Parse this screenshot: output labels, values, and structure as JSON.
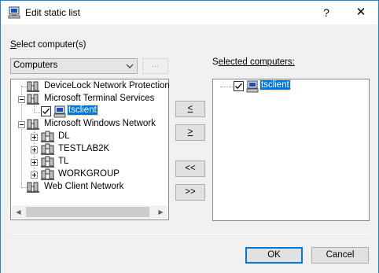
{
  "window": {
    "title": "Edit static list",
    "help_glyph": "?",
    "close_glyph": "✕"
  },
  "left": {
    "label_prefix": "S",
    "label_rest": "elect computer(s)",
    "combo_value": "Computers",
    "browse_label": "...",
    "tree": [
      {
        "label": "DeviceLock Network Protection",
        "icon": "network-icon"
      },
      {
        "label": "Microsoft Terminal Services",
        "icon": "network-icon",
        "expanded": true
      },
      {
        "label": "tsclient",
        "icon": "computer-icon",
        "checked": true,
        "selected": true
      },
      {
        "label": "Microsoft Windows Network",
        "icon": "network-icon",
        "expanded": true
      },
      {
        "label": "DL",
        "icon": "domain-icon"
      },
      {
        "label": "TESTLAB2K",
        "icon": "domain-icon"
      },
      {
        "label": "TL",
        "icon": "domain-icon"
      },
      {
        "label": "WORKGROUP",
        "icon": "domain-icon"
      },
      {
        "label": "Web Client Network",
        "icon": "network-icon"
      }
    ]
  },
  "right": {
    "label_prefix": "S",
    "label_rest": "elected computers:",
    "tree": [
      {
        "label": "tsclient",
        "icon": "computer-icon",
        "checked": true,
        "selected": true
      }
    ]
  },
  "move_buttons": {
    "add": "<",
    "remove": ">",
    "add_all": "<<",
    "remove_all": ">>"
  },
  "footer": {
    "ok": "OK",
    "cancel": "Cancel"
  },
  "colors": {
    "selection": "#0078d7",
    "window_border": "#1883d7",
    "dialog_bg": "#f0f0f0"
  }
}
